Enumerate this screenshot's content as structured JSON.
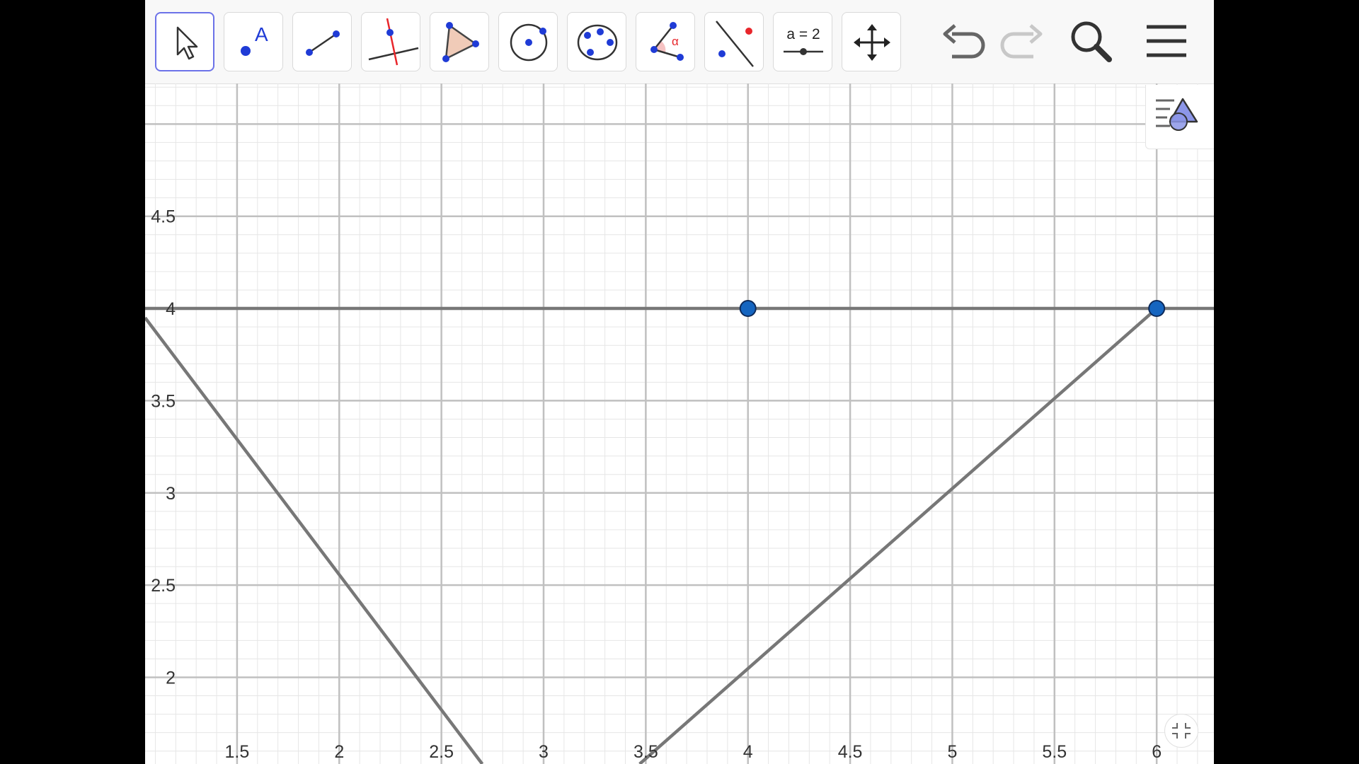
{
  "toolbar": {
    "tools": [
      {
        "name": "move-tool",
        "icon": "cursor-arrow-icon"
      },
      {
        "name": "point-tool",
        "icon": "point-icon",
        "label": "A"
      },
      {
        "name": "segment-tool",
        "icon": "segment-icon"
      },
      {
        "name": "perpendicular-line-tool",
        "icon": "perpendicular-line-icon"
      },
      {
        "name": "polygon-tool",
        "icon": "polygon-icon"
      },
      {
        "name": "circle-center-point-tool",
        "icon": "circle-icon"
      },
      {
        "name": "conic-five-points-tool",
        "icon": "conic-icon"
      },
      {
        "name": "angle-tool",
        "icon": "angle-icon",
        "label": "α"
      },
      {
        "name": "reflect-about-line-tool",
        "icon": "reflect-icon"
      },
      {
        "name": "slider-tool",
        "icon": "slider-icon",
        "label": "a = 2"
      },
      {
        "name": "move-graphics-view-tool",
        "icon": "move-arrows-icon"
      }
    ],
    "selected_tool": "move-tool",
    "undo_icon": "undo-icon",
    "redo_icon": "redo-icon",
    "search_icon": "search-icon",
    "menu_icon": "hamburger-menu-icon"
  },
  "graphics_view": {
    "style_bar_icon": "style-bar-icon",
    "fullscreen_icon": "exit-fullscreen-icon"
  },
  "colors": {
    "accent": "#6c72e8",
    "point_fill": "#1565c0",
    "line": "#777777",
    "grid_major": "#c0c0c0",
    "grid_minor": "#e6e6e6",
    "red": "#e8262b"
  },
  "chart_data": {
    "type": "line",
    "xlim": [
      1.05,
      6.28
    ],
    "ylim": [
      1.53,
      5.22
    ],
    "grid": true,
    "x_ticks": [
      "1.5",
      "2",
      "2.5",
      "3",
      "3.5",
      "4",
      "4.5",
      "5",
      "5.5",
      "6"
    ],
    "y_ticks": [
      "2",
      "2.5",
      "3",
      "3.5",
      "4",
      "4.5"
    ],
    "lines": [
      {
        "name": "horizontal-line",
        "points": [
          [
            1.05,
            4
          ],
          [
            6.28,
            4
          ]
        ]
      },
      {
        "name": "left-descending-line",
        "points": [
          [
            1.05,
            3.95
          ],
          [
            2.7,
            1.53
          ]
        ]
      },
      {
        "name": "right-ascending-line",
        "points": [
          [
            3.47,
            1.53
          ],
          [
            6,
            4
          ]
        ]
      }
    ],
    "points": [
      {
        "x": 4,
        "y": 4
      },
      {
        "x": 6,
        "y": 4
      }
    ]
  }
}
